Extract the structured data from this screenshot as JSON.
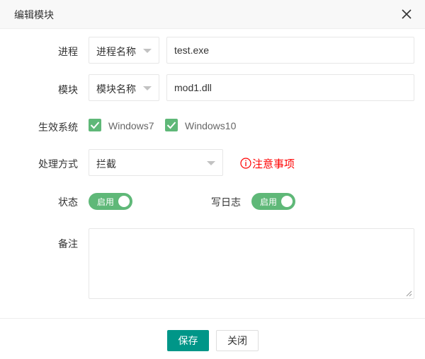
{
  "dialog": {
    "title": "编辑模块"
  },
  "form": {
    "process": {
      "label": "进程",
      "type_value": "进程名称",
      "value": "test.exe"
    },
    "module": {
      "label": "模块",
      "type_value": "模块名称",
      "value": "mod1.dll"
    },
    "systems": {
      "label": "生效系统",
      "options": [
        {
          "label": "Windows7",
          "checked": true
        },
        {
          "label": "Windows10",
          "checked": true
        }
      ]
    },
    "handling": {
      "label": "处理方式",
      "value": "拦截",
      "notice": "注意事项"
    },
    "status": {
      "label": "状态",
      "switch_text": "启用",
      "on": true
    },
    "log": {
      "label": "写日志",
      "switch_text": "启用",
      "on": true
    },
    "remark": {
      "label": "备注",
      "value": ""
    }
  },
  "footer": {
    "save_label": "保存",
    "close_label": "关闭"
  },
  "colors": {
    "accent": "#009688",
    "check_green": "#5fb878",
    "notice_red": "#ff0000"
  },
  "icons": {
    "close": "close-icon",
    "check": "check-icon",
    "info": "info-circle-icon",
    "caret": "caret-down-icon"
  }
}
